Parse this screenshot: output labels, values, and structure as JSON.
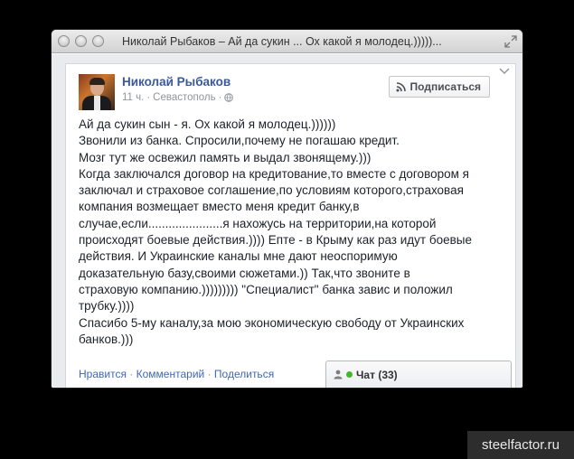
{
  "window": {
    "title": "Николай Рыбаков – Ай да сукин ... Ох какой я молодец.)))))..."
  },
  "post": {
    "author": "Николай Рыбаков",
    "time": "11 ч.",
    "separator": "·",
    "location": "Севастополь",
    "subscribe_label": "Подписаться",
    "text": "Ай да сукин сын - я. Ох какой я молодец.))))))\nЗвонили из банка. Спросили,почему не погашаю кредит.\nМозг тут же освежил память и выдал звонящему.)))\nКогда заключался договор на кредитование,то вместе с договором я\nзаключал и страховое соглашение,по условиям которого,страховая\nкомпания возмещает вместо меня кредит банку,в\nслучае,если......................я нахожусь на территории,на которой\nпроисходят боевые действия.)))) Епте - в Крыму как раз идут боевые\nдействия. И Украинские каналы мне дают неоспоримую\nдоказательную базу,своими сюжетами.)) Так,что звоните в\nстраховую компанию.))))))))) \"Специалист\" банка завис и положил\nтрубку.))))\nСпасибо 5-му каналу,за мою экономическую свободу от Украинских\nбанков.)))"
  },
  "actions": {
    "like": "Нравится",
    "comment": "Комментарий",
    "share": "Поделиться",
    "dot": "·"
  },
  "chat": {
    "label": "Чат (33)"
  },
  "watermark": "steelfactor.ru",
  "colors": {
    "link": "#3b5998",
    "online": "#42b72a",
    "page_bg": "#000000"
  },
  "icons": [
    "close-button-icon",
    "minimize-button-icon",
    "zoom-button-icon",
    "resize-icon",
    "chevron-down-icon",
    "globe-icon",
    "rss-icon",
    "users-icon"
  ]
}
